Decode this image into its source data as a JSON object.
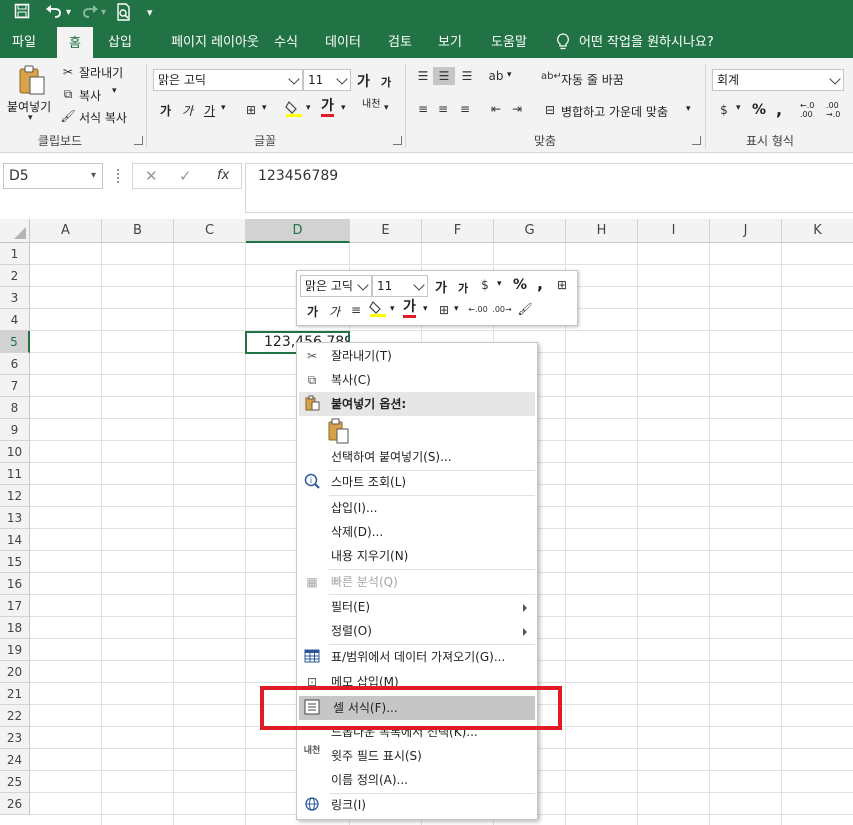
{
  "title_bar": {
    "save_icon": "save-icon",
    "undo_icon": "undo-icon",
    "redo_icon": "redo-icon",
    "print_preview_icon": "print-preview-icon",
    "customize_icon": "customize-toolbar-icon"
  },
  "tabs": [
    {
      "label": "파일"
    },
    {
      "label": "홈"
    },
    {
      "label": "삽입"
    },
    {
      "label": "페이지 레이아웃"
    },
    {
      "label": "수식"
    },
    {
      "label": "데이터"
    },
    {
      "label": "검토"
    },
    {
      "label": "보기"
    },
    {
      "label": "도움말"
    }
  ],
  "tell_me": "어떤 작업을 원하시나요?",
  "ribbon": {
    "clipboard": {
      "paste": "붙여넣기",
      "cut": "잘라내기",
      "copy": "복사",
      "format_painter": "서식 복사",
      "label": "클립보드"
    },
    "font": {
      "name": "맑은 고딕",
      "size": "11",
      "grow": "가",
      "shrink": "가",
      "bold": "가",
      "italic": "가",
      "underline": "가",
      "font_color": "가",
      "phonetic": "내천",
      "label": "글꼴"
    },
    "alignment": {
      "wrap": "자동 줄 바꿈",
      "merge": "병합하고 가운데 맞춤",
      "label": "맞춤"
    },
    "number": {
      "format": "회계",
      "percent": "%",
      "comma": ",",
      "inc_decimal": "←.0 .00",
      "dec_decimal": ".00 →.0",
      "label": "표시 형식"
    }
  },
  "formula_bar": {
    "name_box": "D5",
    "fx": "fx",
    "cancel": "✕",
    "enter": "✓",
    "content": "123456789"
  },
  "sheet": {
    "columns": [
      "A",
      "B",
      "C",
      "D",
      "E",
      "F",
      "G",
      "H",
      "I",
      "J",
      "K"
    ],
    "rows": [
      "1",
      "2",
      "3",
      "4",
      "5",
      "6",
      "7",
      "8",
      "9",
      "10",
      "11",
      "12",
      "13",
      "14",
      "15",
      "16",
      "17",
      "18",
      "19",
      "20",
      "21",
      "22",
      "23",
      "24",
      "25",
      "26"
    ],
    "selected_cell": "D5",
    "cell_D5_value": "123,456,789"
  },
  "mini_toolbar": {
    "font_name": "맑은 고딕",
    "font_size": "11",
    "grow": "가",
    "shrink": "가",
    "percent": "%",
    "comma": ",",
    "bold": "가",
    "italic": "가",
    "font_color": "가"
  },
  "context_menu": {
    "cut": "잘라내기(T)",
    "copy": "복사(C)",
    "paste_options": "붙여넣기 옵션:",
    "paste_special": "선택하여 붙여넣기(S)...",
    "smart_lookup": "스마트 조회(L)",
    "insert": "삽입(I)...",
    "delete": "삭제(D)...",
    "clear": "내용 지우기(N)",
    "quick_analysis": "빠른 분석(Q)",
    "filter": "필터(E)",
    "sort": "정렬(O)",
    "get_data": "표/범위에서 데이터 가져오기(G)...",
    "insert_note": "메모 삽입(M)",
    "format_cells": "셀 서식(F)...",
    "pick_list": "드롭다운 목록에서 선택(K)...",
    "phonetic": "윗주 필드 표시(S)",
    "define_name": "이름 정의(A)...",
    "link": "링크(I)"
  },
  "highlight_color": "#e21c24",
  "accent_color": "#217346"
}
